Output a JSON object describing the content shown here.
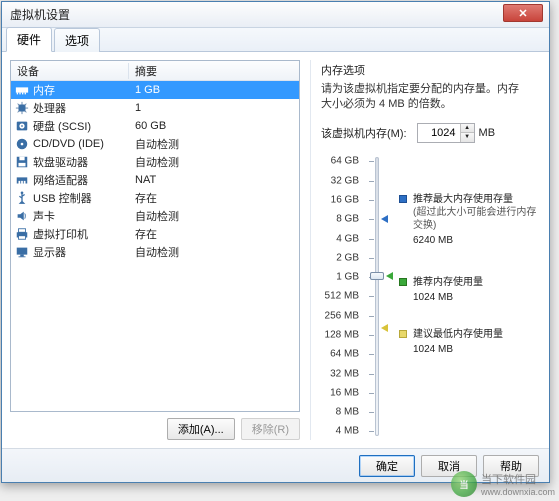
{
  "window": {
    "title": "虚拟机设置"
  },
  "tabs": {
    "hardware": "硬件",
    "options": "选项"
  },
  "device_list": {
    "header_device": "设备",
    "header_summary": "摘要",
    "rows": [
      {
        "icon": "memory",
        "name": "内存",
        "summary": "1 GB",
        "selected": true
      },
      {
        "icon": "cpu",
        "name": "处理器",
        "summary": "1"
      },
      {
        "icon": "hdd",
        "name": "硬盘 (SCSI)",
        "summary": "60 GB"
      },
      {
        "icon": "disc",
        "name": "CD/DVD (IDE)",
        "summary": "自动检测"
      },
      {
        "icon": "floppy",
        "name": "软盘驱动器",
        "summary": "自动检测"
      },
      {
        "icon": "nic",
        "name": "网络适配器",
        "summary": "NAT"
      },
      {
        "icon": "usb",
        "name": "USB 控制器",
        "summary": "存在"
      },
      {
        "icon": "sound",
        "name": "声卡",
        "summary": "自动检测"
      },
      {
        "icon": "printer",
        "name": "虚拟打印机",
        "summary": "存在"
      },
      {
        "icon": "display",
        "name": "显示器",
        "summary": "自动检测"
      }
    ]
  },
  "left_buttons": {
    "add": "添加(A)...",
    "remove": "移除(R)"
  },
  "memory_panel": {
    "title": "内存选项",
    "desc_line1": "请为该虚拟机指定要分配的内存量。内存",
    "desc_line2": "大小必须为 4 MB 的倍数。",
    "input_label": "该虚拟机内存(M):",
    "value": "1024",
    "unit": "MB",
    "ticks": [
      "64 GB",
      "32 GB",
      "16 GB",
      "8 GB",
      "4 GB",
      "2 GB",
      "1 GB",
      "512 MB",
      "256 MB",
      "128 MB",
      "64 MB",
      "32 MB",
      "16 MB",
      "8 MB",
      "4 MB"
    ],
    "legend_max": {
      "title": "推荐最大内存使用存量",
      "sub": "(超过此大小可能会进行内存交换)",
      "val": "6240 MB"
    },
    "legend_rec": {
      "title": "推荐内存使用量",
      "val": "1024 MB"
    },
    "legend_min": {
      "title": "建议最低内存使用量",
      "val": "1024 MB"
    }
  },
  "footer": {
    "ok": "确定",
    "cancel": "取消",
    "help": "帮助"
  },
  "watermark": {
    "logo_text": "当",
    "line1": "当下软件园",
    "line2": "www.downxia.com"
  }
}
